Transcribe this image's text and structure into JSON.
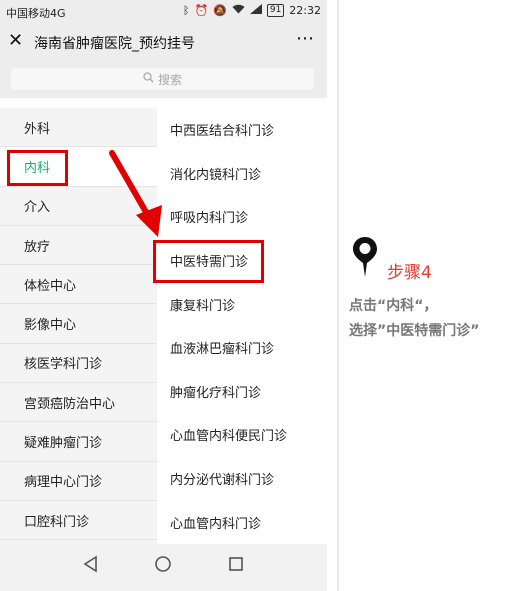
{
  "status_bar": {
    "carrier": "中国移动4G",
    "battery": "91",
    "time": "22:32",
    "icons": [
      "bluetooth-icon",
      "alarm-icon",
      "silent-icon",
      "wifi-icon",
      "signal-icon",
      "battery-icon"
    ]
  },
  "header": {
    "close_icon": "close-icon",
    "title": "海南省肿瘤医院_预约挂号",
    "more_icon": "more-icon"
  },
  "search": {
    "icon": "search-icon",
    "placeholder": "搜索"
  },
  "categories": [
    "外科",
    "内科",
    "介入",
    "放疗",
    "体检中心",
    "影像中心",
    "核医学科门诊",
    "宫颈癌防治中心",
    "疑难肿瘤门诊",
    "病理中心门诊",
    "口腔科门诊"
  ],
  "selected_category": "内科",
  "departments": [
    "中西医结合科门诊",
    "消化内镜科门诊",
    "呼吸内科门诊",
    "中医特需门诊",
    "康复科门诊",
    "血液淋巴瘤科门诊",
    "肿瘤化疗科门诊",
    "心血管内科便民门诊",
    "内分泌代谢科门诊",
    "心血管内科门诊"
  ],
  "highlighted_department": "中医特需门诊",
  "nav_bar": {
    "back_icon": "back-icon",
    "home_icon": "home-icon",
    "recents_icon": "recents-icon"
  },
  "annotation": {
    "step": "步骤4",
    "line1": "点击“内科“，",
    "line2": "选择”中医特需门诊”",
    "accent_color": "#e00000",
    "pin_icon": "location-pin-icon"
  },
  "colors": {
    "active_green": "#1aad6c",
    "highlight_red": "#e00000"
  }
}
